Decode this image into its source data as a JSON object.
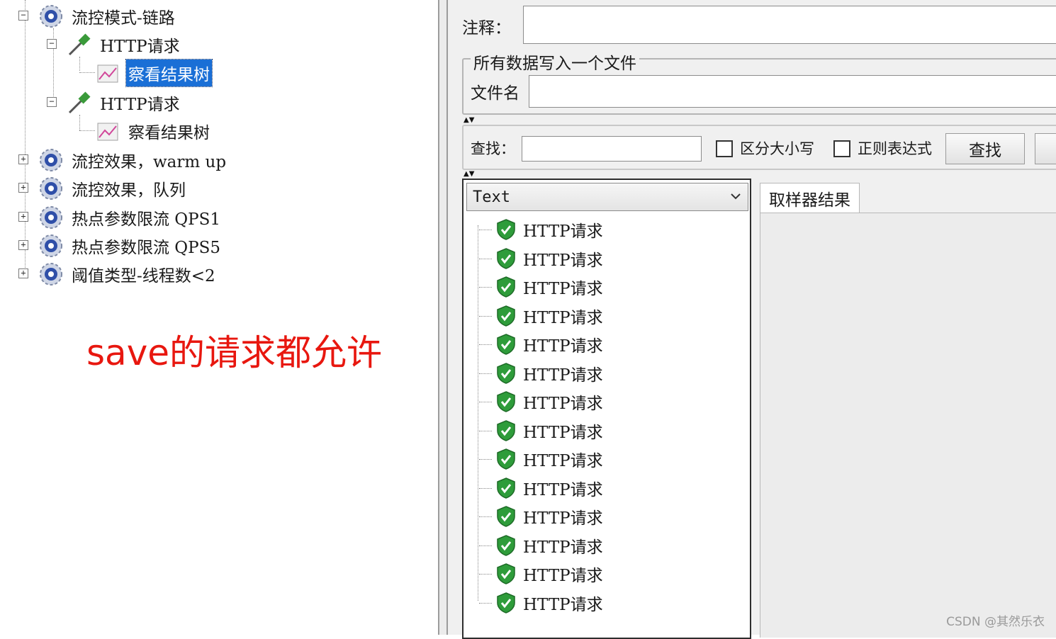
{
  "tree": {
    "items": [
      {
        "label": "流控模式-链路",
        "icon": "gear-icon",
        "expander": "⊟"
      },
      {
        "label": "HTTP请求",
        "icon": "pipette-icon",
        "expander": "⊟"
      },
      {
        "label": "察看结果树",
        "icon": "chart-icon",
        "selected": true
      },
      {
        "label": "HTTP请求",
        "icon": "pipette-icon",
        "expander": "⊟"
      },
      {
        "label": "察看结果树",
        "icon": "chart-icon"
      },
      {
        "label": "流控效果，warm up",
        "icon": "gear-icon",
        "expander": "⊞"
      },
      {
        "label": "流控效果，队列",
        "icon": "gear-icon",
        "expander": "⊞"
      },
      {
        "label": "热点参数限流 QPS1",
        "icon": "gear-icon",
        "expander": "⊞"
      },
      {
        "label": "热点参数限流 QPS5",
        "icon": "gear-icon",
        "expander": "⊞"
      },
      {
        "label": "阈值类型-线程数<2",
        "icon": "gear-icon",
        "expander": "⊞"
      }
    ]
  },
  "annotation": "save的请求都允许",
  "panel": {
    "comment_label": "注释：",
    "file_group_label": "所有数据写入一个文件",
    "filename_label": "文件名",
    "search_label": "查找：",
    "case_sensitive_label": "区分大小写",
    "regex_label": "正则表达式",
    "search_button": "查找",
    "renderer": "Text",
    "results": [
      "HTTP请求",
      "HTTP请求",
      "HTTP请求",
      "HTTP请求",
      "HTTP请求",
      "HTTP请求",
      "HTTP请求",
      "HTTP请求",
      "HTTP请求",
      "HTTP请求",
      "HTTP请求",
      "HTTP请求",
      "HTTP请求",
      "HTTP请求"
    ],
    "tab_sampler_result": "取样器结果"
  },
  "watermark": "CSDN @其然乐衣",
  "colors": {
    "selection": "#1a6fd6",
    "annotation": "#e8170f",
    "shield": "#2e9c3a"
  }
}
